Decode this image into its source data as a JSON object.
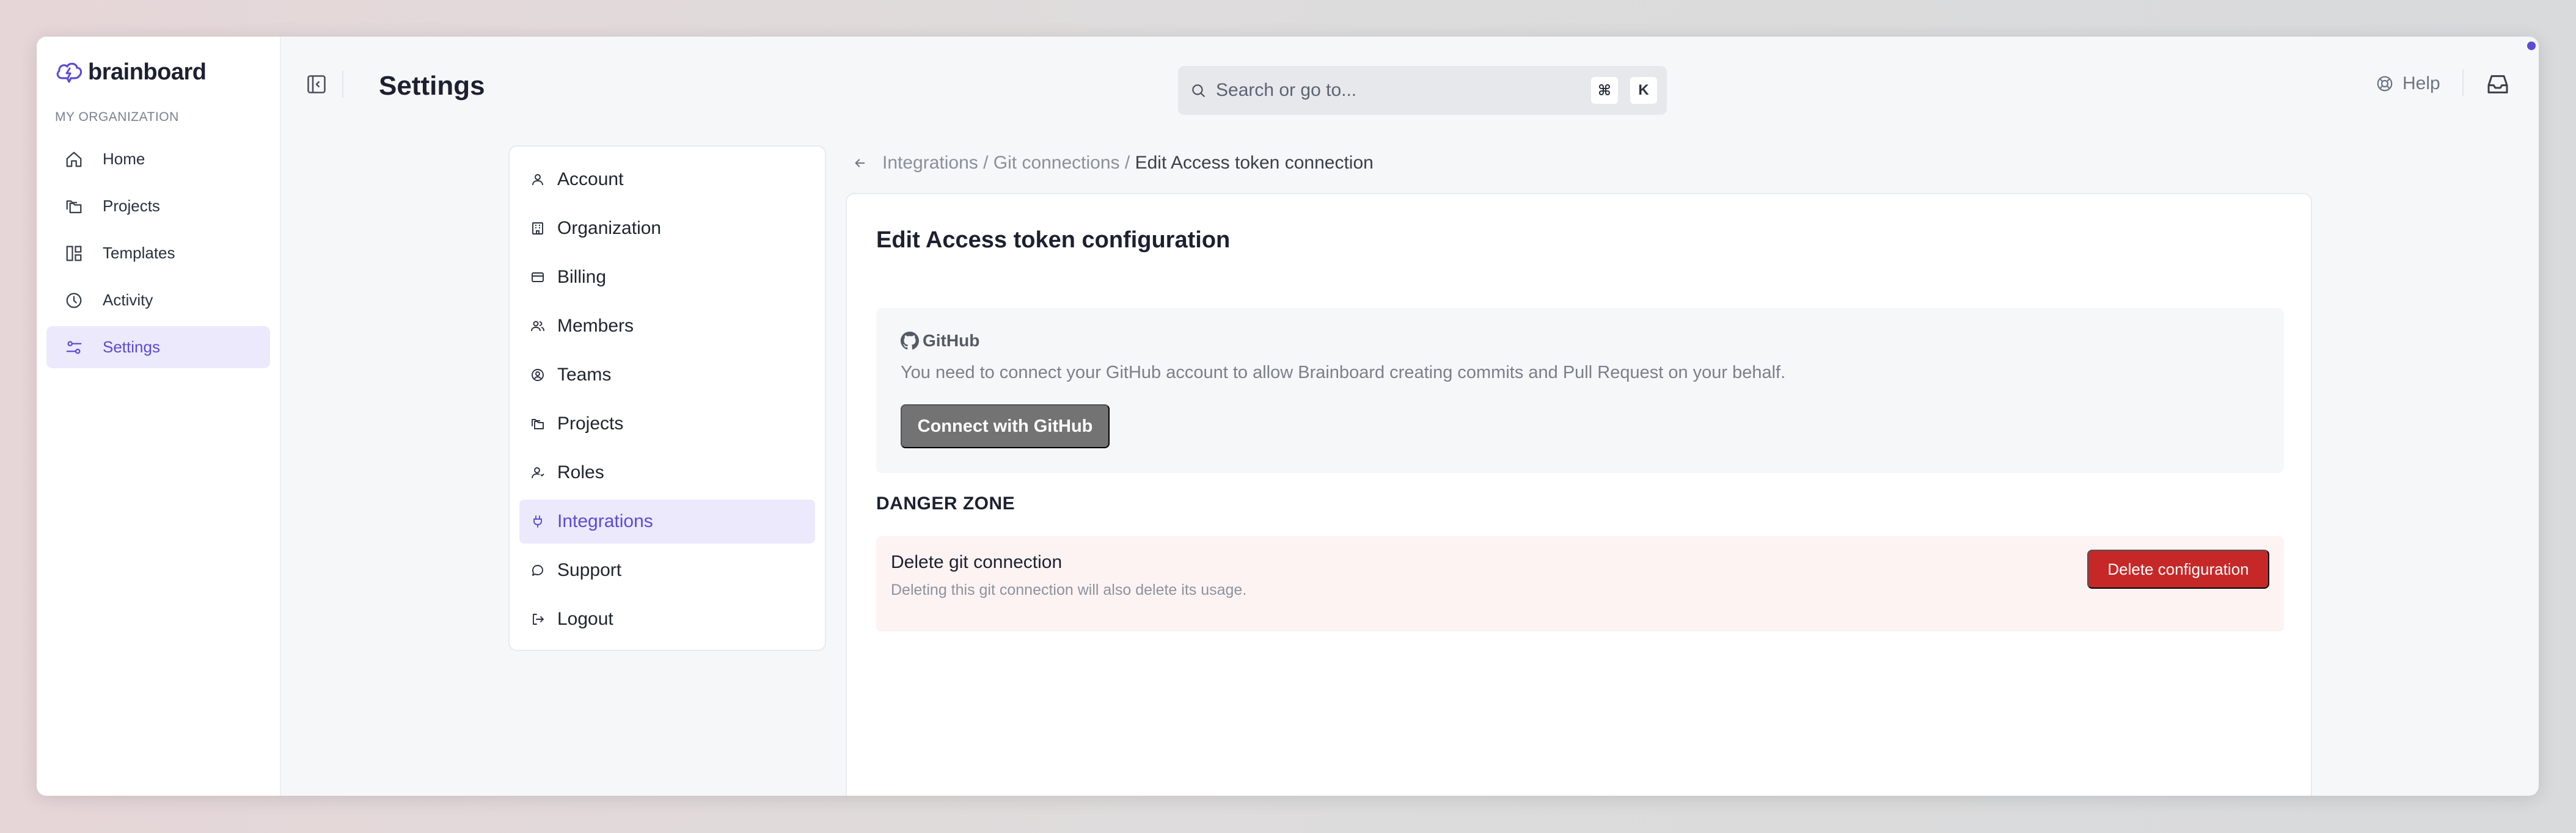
{
  "app": {
    "brand": "brainboard",
    "brand_color": "#5b4bd6"
  },
  "sidebar": {
    "section_label": "MY ORGANIZATION",
    "items": [
      {
        "label": "Home",
        "icon": "home-icon"
      },
      {
        "label": "Projects",
        "icon": "folders-icon"
      },
      {
        "label": "Templates",
        "icon": "layout-icon"
      },
      {
        "label": "Activity",
        "icon": "clock-icon"
      },
      {
        "label": "Settings",
        "icon": "sliders-icon",
        "active": true
      }
    ]
  },
  "header": {
    "title": "Settings",
    "search_placeholder": "Search or go to...",
    "shortcut_keys": [
      "⌘",
      "K"
    ],
    "help_label": "Help"
  },
  "settings_menu": {
    "items": [
      {
        "label": "Account",
        "icon": "user-icon"
      },
      {
        "label": "Organization",
        "icon": "building-icon"
      },
      {
        "label": "Billing",
        "icon": "credit-card-icon"
      },
      {
        "label": "Members",
        "icon": "users-icon"
      },
      {
        "label": "Teams",
        "icon": "team-icon"
      },
      {
        "label": "Projects",
        "icon": "folders-icon"
      },
      {
        "label": "Roles",
        "icon": "user-role-icon"
      },
      {
        "label": "Integrations",
        "icon": "plug-icon",
        "active": true
      },
      {
        "label": "Support",
        "icon": "chat-icon"
      },
      {
        "label": "Logout",
        "icon": "logout-icon"
      }
    ]
  },
  "breadcrumb": {
    "links": "Integrations / Git connections /",
    "current": "Edit Access token connection"
  },
  "content": {
    "title": "Edit Access token configuration",
    "github": {
      "logo_text": "GitHub",
      "description": "You need to connect your GitHub account to allow Brainboard creating commits and Pull Request on your behalf.",
      "button_label": "Connect with GitHub"
    },
    "danger_zone": {
      "title": "DANGER ZONE",
      "item_title": "Delete git connection",
      "item_description": "Deleting this git connection will also delete its usage.",
      "button_label": "Delete configuration",
      "button_color": "#c62828"
    }
  }
}
